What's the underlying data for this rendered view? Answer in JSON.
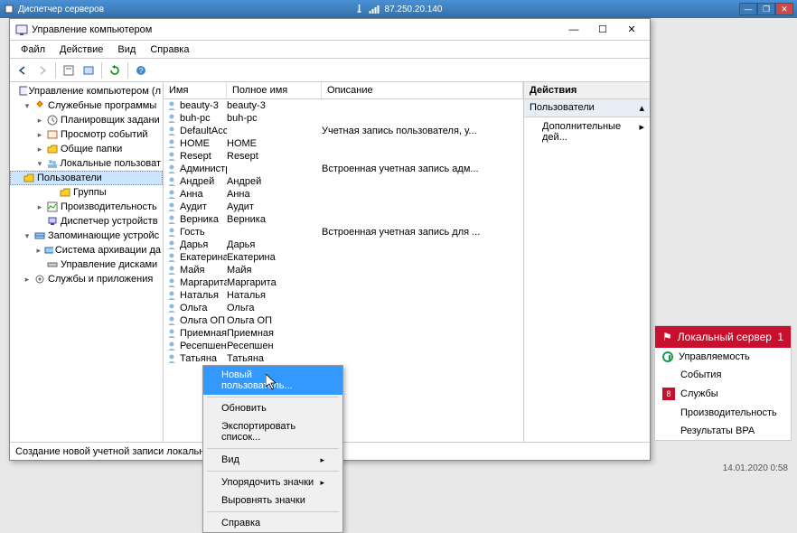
{
  "remote": {
    "title": "Диспетчер серверов",
    "ip": "87.250.20.140"
  },
  "mmc": {
    "title": "Управление компьютером",
    "menu": {
      "file": "Файл",
      "action": "Действие",
      "view": "Вид",
      "help": "Справка"
    },
    "tree": {
      "root": "Управление компьютером (л",
      "sys_tools": "Служебные программы",
      "task_sched": "Планировщик задани",
      "event_viewer": "Просмотр событий",
      "shared": "Общие папки",
      "local_users": "Локальные пользоват",
      "users": "Пользователи",
      "groups": "Группы",
      "perf": "Производительность",
      "devmgr": "Диспетчер устройств",
      "storage": "Запоминающие устройс",
      "backup": "Система архивации да",
      "diskmgr": "Управление дисками",
      "services_apps": "Службы и приложения"
    },
    "columns": {
      "name": "Имя",
      "fullname": "Полное имя",
      "description": "Описание"
    },
    "users": [
      {
        "name": "beauty-3",
        "full": "beauty-3",
        "desc": ""
      },
      {
        "name": "buh-pc",
        "full": "buh-pc",
        "desc": ""
      },
      {
        "name": "DefaultAcco...",
        "full": "",
        "desc": "Учетная запись пользователя, у..."
      },
      {
        "name": "HOME",
        "full": "HOME",
        "desc": ""
      },
      {
        "name": "Resept",
        "full": "Resept",
        "desc": ""
      },
      {
        "name": "Администр...",
        "full": "",
        "desc": "Встроенная учетная запись адм..."
      },
      {
        "name": "Андрей",
        "full": "Андрей",
        "desc": ""
      },
      {
        "name": "Анна",
        "full": "Анна",
        "desc": ""
      },
      {
        "name": "Аудит",
        "full": "Аудит",
        "desc": ""
      },
      {
        "name": "Верника",
        "full": "Верника",
        "desc": ""
      },
      {
        "name": "Гость",
        "full": "",
        "desc": "Встроенная учетная запись для ..."
      },
      {
        "name": "Дарья",
        "full": "Дарья",
        "desc": ""
      },
      {
        "name": "Екатерина",
        "full": "Екатерина",
        "desc": ""
      },
      {
        "name": "Майя",
        "full": "Майя",
        "desc": ""
      },
      {
        "name": "Маргарита",
        "full": "Маргарита",
        "desc": ""
      },
      {
        "name": "Наталья",
        "full": "Наталья",
        "desc": ""
      },
      {
        "name": "Ольга",
        "full": "Ольга",
        "desc": ""
      },
      {
        "name": "Ольга ОП",
        "full": "Ольга ОП",
        "desc": ""
      },
      {
        "name": "Приемная",
        "full": "Приемная",
        "desc": ""
      },
      {
        "name": "Ресепшен",
        "full": "Ресепшен",
        "desc": ""
      },
      {
        "name": "Татьяна",
        "full": "Татьяна",
        "desc": ""
      }
    ],
    "actions": {
      "header": "Действия",
      "sub": "Пользователи",
      "more": "Дополнительные дей..."
    },
    "status": "Создание новой учетной записи локального польз"
  },
  "context": {
    "new_user": "Новый пользователь...",
    "refresh": "Обновить",
    "export": "Экспортировать список...",
    "view": "Вид",
    "arrange": "Упорядочить значки",
    "align": "Выровнять значки",
    "help": "Справка"
  },
  "notif": {
    "title": "Локальный сервер",
    "count": "1",
    "manage": "Управляемость",
    "events": "События",
    "services": "Службы",
    "services_badge": "8",
    "perf": "Производительность",
    "bpa": "Результаты BPA"
  },
  "timestamp": "14.01.2020 0:58"
}
